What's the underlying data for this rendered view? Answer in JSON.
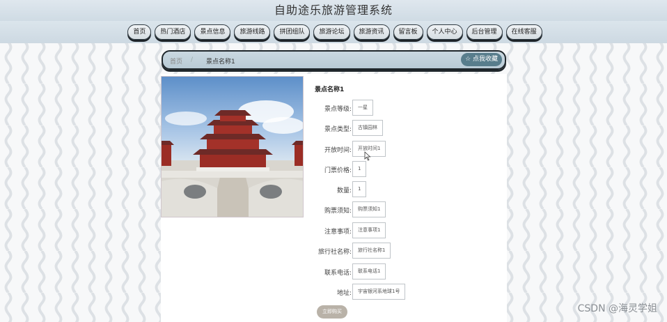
{
  "header": {
    "title": "自助途乐旅游管理系统"
  },
  "nav": {
    "items": [
      {
        "label": "首页",
        "name": "nav-home"
      },
      {
        "label": "热门酒店",
        "name": "nav-hotels"
      },
      {
        "label": "景点信息",
        "name": "nav-attractions"
      },
      {
        "label": "旅游线路",
        "name": "nav-routes"
      },
      {
        "label": "拼团组队",
        "name": "nav-group-tours"
      },
      {
        "label": "旅游论坛",
        "name": "nav-forum"
      },
      {
        "label": "旅游资讯",
        "name": "nav-news"
      },
      {
        "label": "留言板",
        "name": "nav-message-board"
      },
      {
        "label": "个人中心",
        "name": "nav-personal-center"
      },
      {
        "label": "后台管理",
        "name": "nav-admin"
      },
      {
        "label": "在线客服",
        "name": "nav-customer-service"
      }
    ]
  },
  "breadcrumb": {
    "home": "首页",
    "separator": "/",
    "current": "景点名称1"
  },
  "favorite_button": {
    "label": "☆ 点我收藏"
  },
  "detail": {
    "title": "景点名称1",
    "fields": [
      {
        "label": "景点等级:",
        "value": "一星"
      },
      {
        "label": "景点类型:",
        "value": "古镇园林"
      },
      {
        "label": "开放时间:",
        "value": "开放时间1"
      },
      {
        "label": "门票价格:",
        "value": "1"
      },
      {
        "label": "数量:",
        "value": "1"
      },
      {
        "label": "购票须知:",
        "value": "购票须知1"
      },
      {
        "label": "注意事项:",
        "value": "注意事项1"
      },
      {
        "label": "旅行社名称:",
        "value": "旅行社名称1"
      },
      {
        "label": "联系电话:",
        "value": "联系电话1"
      },
      {
        "label": "地址:",
        "value": "宇宙银河系地球1号"
      }
    ]
  },
  "buy_button": {
    "label": "立即购买"
  },
  "watermark": "CSDN @海灵学姐",
  "colors": {
    "header_bg": "#d6e0e8",
    "nav_button_bg": "#e6ebee",
    "favorite_bg": "#587d8c",
    "buy_bg": "#b9b2a8"
  }
}
